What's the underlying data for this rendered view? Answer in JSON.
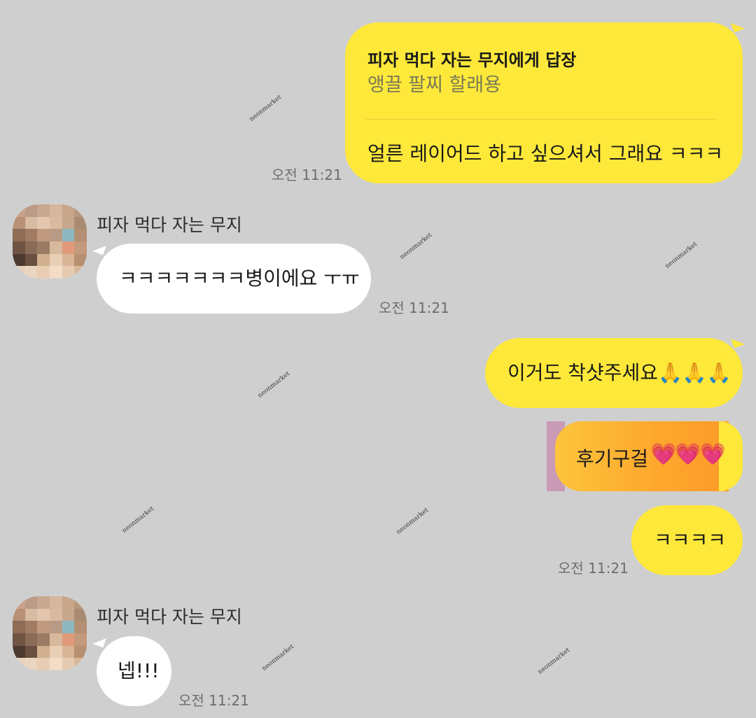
{
  "colors": {
    "background": "#cfcfcf",
    "my_bubble": "#fee83a",
    "their_bubble": "#ffffff",
    "time_text": "#6d6d6d"
  },
  "messages": {
    "reply": {
      "reply_to": "피자 먹다 자는 무지에게 답장",
      "quoted": "앵끌 팔찌 할래용",
      "text": "얼른 레이어드 하고 싶으셔서 그래요 ㅋㅋㅋ",
      "time": "오전 11:21"
    },
    "their1": {
      "sender": "피자 먹다 자는 무지",
      "text": "ㅋㅋㅋㅋㅋㅋㅋ병이에요 ㅜㅠ",
      "time": "오전 11:21"
    },
    "me2": {
      "text": "이거도 착샷주세요🙏🙏🙏"
    },
    "me3": {
      "text": "후기구걸",
      "hearts": "💗💗💗"
    },
    "me4": {
      "text": "ㅋㅋㅋㅋ",
      "time": "오전 11:21"
    },
    "their2": {
      "sender": "피자 먹다 자는 무지",
      "text": "넵!!!",
      "time": "오전 11:21"
    }
  },
  "avatar": {
    "icon": "pixelated-profile-avatar",
    "pixels": [
      "#c9a18b",
      "#bb9a86",
      "#c8a98f",
      "#d6b8a0",
      "#c7a68a",
      "#b8977c",
      "#b89075",
      "#d8bba3",
      "#e3c6ad",
      "#d9bba1",
      "#c6a88c",
      "#a98b72",
      "#8f6c55",
      "#a27b63",
      "#c09a7f",
      "#b89b85",
      "#8fb7c2",
      "#b38f74",
      "#6e5443",
      "#8a6b56",
      "#9c7b65",
      "#d7b99b",
      "#e09a7a",
      "#c49a7c",
      "#4c3a30",
      "#6a5040",
      "#d0b08f",
      "#e8cfb3",
      "#d8b596",
      "#b69070",
      "#e7d1bc",
      "#ead5c1",
      "#e9cdb3",
      "#f2dcc5",
      "#e6cbb0",
      "#d7b89a"
    ]
  },
  "watermark": {
    "text": "neonmarket"
  }
}
